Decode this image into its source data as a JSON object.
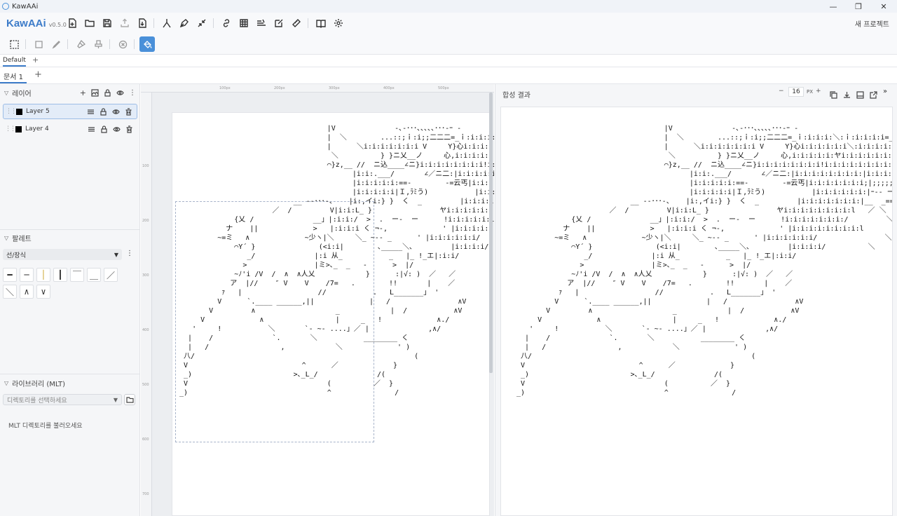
{
  "window": {
    "title": "KawAAi",
    "minimize": "—",
    "maximize": "❐",
    "close": "✕"
  },
  "toolbar": {
    "logo": "KawAAi",
    "version": "v0.5.0",
    "new_project": "새 프로젝트",
    "icons": [
      "new-file-icon",
      "open-folder-icon",
      "save-icon",
      "export-icon",
      "import-icon",
      "merge-icon",
      "pen-icon",
      "collapse-icon",
      "link-icon",
      "grid-icon",
      "text-align-icon",
      "edit-box-icon",
      "ruler-icon",
      "book-icon",
      "gear-icon"
    ]
  },
  "toolbar2": {
    "icons": [
      "select-rect-icon",
      "rectangle-icon",
      "brush-icon",
      "paint-brush-icon",
      "stamp-icon",
      "cancel-icon",
      "fill-bucket-icon"
    ],
    "active": "fill-bucket-icon"
  },
  "layer_tabs": {
    "default_label": "Default",
    "add": "+"
  },
  "doc_tabs": {
    "active_label": "문서 1",
    "add": "+"
  },
  "layers_panel": {
    "title": "레이어",
    "items": [
      {
        "name": "Layer 5",
        "color": "#000000",
        "selected": true
      },
      {
        "name": "Layer 4",
        "color": "#000000",
        "selected": false
      }
    ]
  },
  "palette_panel": {
    "title": "팔레트",
    "category": "선/장식",
    "glyphs": [
      "━",
      "─",
      "│",
      "┃",
      "￣",
      "＿",
      "／",
      "＼",
      "∧",
      "∨"
    ]
  },
  "library_panel": {
    "title": "라이브러리 (MLT)",
    "placeholder": "디렉토리를 선택하세요",
    "empty_message": "MLT 디렉토리를 불러오세요"
  },
  "rulers": {
    "top": [
      "100px",
      "200px",
      "300px",
      "400px",
      "500px"
    ],
    "left": [
      "100",
      "200",
      "300",
      "400",
      "500",
      "600",
      "700"
    ]
  },
  "composite_panel": {
    "title": "합성 결과",
    "zoom_minus": "−",
    "zoom_value": "16",
    "zoom_unit": "PX",
    "zoom_plus": "+"
  },
  "art_text": "                                    |V              -､-･･･､､､､､･･･-ｰ -\n                                    |  ＼        ...::;ｉ:i;;二二二=_ｉ:i:i:i:＼:ｉ:i:i:i:i=_\n                                    |      ＼i:i:i:i:i:i:i V     Y}心i:i:i:i:i:i＼:i:i:i:i:i:i=_\n                                     ＼          } }ニ乂__ノ     心,i:i:i:i:i:ヤi:i:i:i:i:i:i:,\n                                    ⌒}z,__ //  ニ込____∠ニ}i:i:i:i:i:i:i:i!i:i:i:i:i:i:i:i:V/\n                                          |i:i:.___/       ∠／ニ二:|i:i:i:i:i:i:i:i:|i:i:i:i:i:i:i:i:V/\n                                          |i:i:i:i:i:==-        -=云丐|i:i:i:i:i:i:i;|;;;;;;;;;;;;;;;..}}}z≦三三ミ\n                                          |i:i:i:i:i|Ｉ,ﾗﾐう)           |i:i:i:i:i:i:|ｰ-- ー    >ﾐｯ,ﾐｯ､､\n                            __ -‐･･･-、   |i:,イi:} }  く  _         |i:i:i:i:i:i:i:|__  _==ニ }ﾐｯ,ﾐｯ､､\n                       ／  /         V|i:i:L_ }                ヤi:i:i:i:i:i:i:i:l   ／ ＼\n              {乂 /              __」|:i:i:/  >  .  ー-  ー      !i:i:i:i:i:i:i:/         ＼        ー ー ¬\n            ナ    ||             >   |:i:i:i く ¬‐,             ' |i:i:i:i:i:i:i:i:l        ,.-‐======-‐､\n          ~=ミ   ∧             ~少ヽ|＼     ＼_ ~-‐ _      ' |i:i:i:i:i:i/                ＼\n              ⌒Y´ }               (<i:i|        ､_____＼､         |i:i:i:i/          ＼\n                 _/              |:i 从_           _   |_ !_エ|:i:i/\n                >                |ミ>､_  _   -      >  |/\n              ~ﾉ'i /V  /  ∧  ∧人乂            }      :|√: )  ／   ／\n             ア  |//    ″ V    V    /7=   .        !!       |    ／\n           ｧ   |                  //           .   L_______」 '\n          V      `.____ ______,||             |   /                ∧V\n        V         ∧                   _            |  /           ∧V\n      V             ∧                 |     _   !             ∧./\n    '     !           ＼       `‐ ~‐ ....」／ |              ,∧/\n   |    /              `.       ＼           ________ く\n   |   /                 ,            ＼             ' )\n  八/                                                    (\n  V                           ^      ／             }\n  _)                        >､_L_/              /(\n  V                                 (          ／  }\n _)                                 ^               /"
}
